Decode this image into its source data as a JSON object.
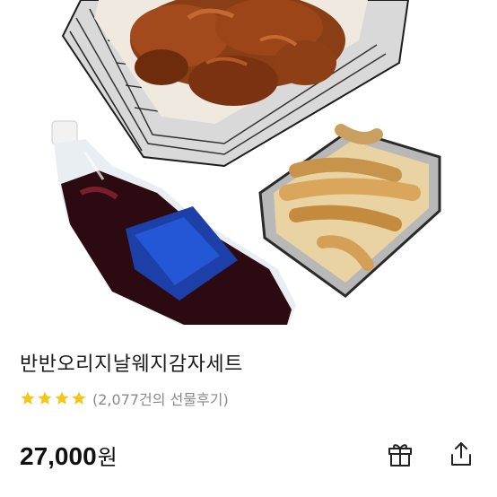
{
  "product": {
    "title": "반반오리지날웨지감자세트",
    "rating": 4,
    "rating_max": 4,
    "review_text": "(2,077건의 선물후기)",
    "price_amount": "27,000",
    "price_unit": "원"
  },
  "actions": {
    "gift_icon": "gift-icon",
    "share_icon": "share-icon"
  },
  "colors": {
    "star": "#f5c518",
    "text": "#1a1a1a",
    "subtext": "#8a8a8a"
  }
}
